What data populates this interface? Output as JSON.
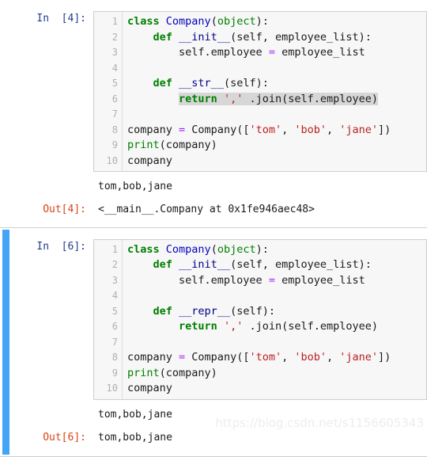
{
  "notebook": {
    "watermark": "https://blog.csdn.net/s1156605343",
    "cells": [
      {
        "id": "cell-1",
        "selected": false,
        "input_prompt": "In  [4]:",
        "line_numbers": [
          "1",
          "2",
          "3",
          "4",
          "5",
          "6",
          "7",
          "8",
          "9",
          "10"
        ],
        "code": [
          "class Company(object):",
          "    def __init__(self, employee_list):",
          "        self.employee = employee_list",
          "",
          "    def __str__(self):",
          "        return ',' .join(self.employee)",
          "",
          "company = Company(['tom', 'bob', 'jane'])",
          "print(company)",
          "company"
        ],
        "highlighted_line_index": 5,
        "stdout": "tom,bob,jane",
        "output_prompt": "Out[4]:",
        "output_text": "<__main__.Company at 0x1fe946aec48>"
      },
      {
        "id": "cell-2",
        "selected": true,
        "input_prompt": "In  [6]:",
        "line_numbers": [
          "1",
          "2",
          "3",
          "4",
          "5",
          "6",
          "7",
          "8",
          "9",
          "10"
        ],
        "code": [
          "class Company(object):",
          "    def __init__(self, employee_list):",
          "        self.employee = employee_list",
          "",
          "    def __repr__(self):",
          "        return ',' .join(self.employee)",
          "",
          "company = Company(['tom', 'bob', 'jane'])",
          "print(company)",
          "company"
        ],
        "highlighted_line_index": -1,
        "stdout": "tom,bob,jane",
        "output_prompt": "Out[6]:",
        "output_text": "tom,bob,jane"
      }
    ]
  },
  "colors": {
    "keyword": "#008000",
    "class_name": "#0000c0",
    "string": "#ba2121",
    "operator": "#aa22ff",
    "in_prompt": "#233c8c",
    "out_prompt": "#d84315",
    "selected_bar": "#42a5f5",
    "code_bg": "#f7f7f7",
    "highlight_bg": "#d7d7d7"
  }
}
